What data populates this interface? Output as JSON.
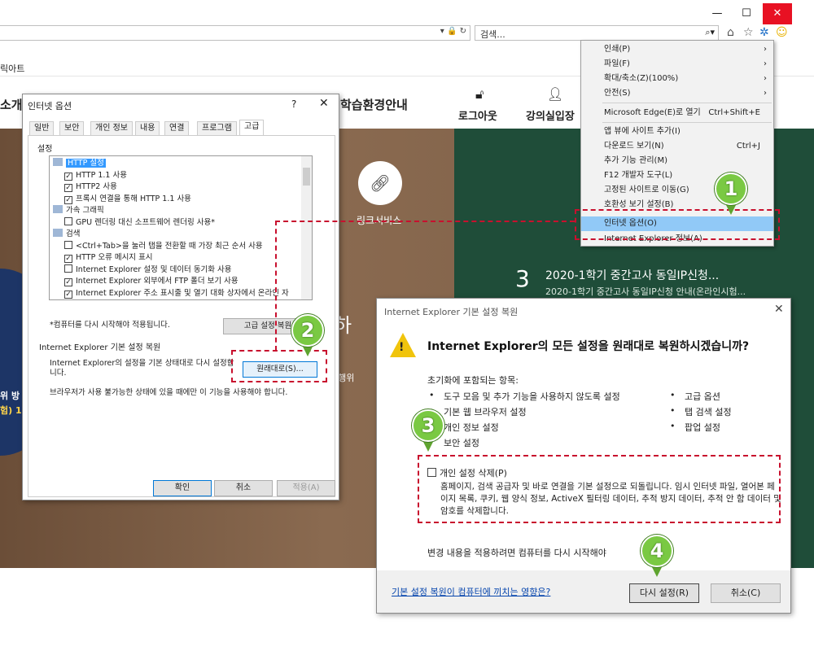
{
  "browser": {
    "window_minimize": "—",
    "window_maximize": "☐",
    "window_close": "✕",
    "search_placeholder": "검색...",
    "address_icons": "▾ 🔒 ↻",
    "search_icon": "⌕▾",
    "favbar_text": "릭아트"
  },
  "site": {
    "nav_left": "소개",
    "nav_env": "학습환경안내",
    "nav_logout": "로그아웃",
    "nav_lecture": "강의실입장",
    "link_service": "링크서비스",
    "notice_num": "3",
    "notice_title": "2020-1학기 중간고사 동일IP신청...",
    "notice_sub": "2020-1학기 중간고사 동일IP신청 안내(온라인시험...",
    "hero_char": "하",
    "hero_small": "정행위",
    "hero_left_1": "위 방",
    "hero_left_2": "험) 1"
  },
  "tools_menu": {
    "items": [
      {
        "label": "인쇄(P)",
        "arrow": "›"
      },
      {
        "label": "파일(F)",
        "arrow": "›"
      },
      {
        "label": "확대/축소(Z)(100%)",
        "arrow": "›"
      },
      {
        "label": "안전(S)",
        "arrow": "›"
      },
      {
        "label": "Microsoft Edge(E)로 열기",
        "shortcut": "Ctrl+Shift+E"
      },
      {
        "label": "앱 뷰에 사이트 추가(I)"
      },
      {
        "label": "다운로드 보기(N)",
        "shortcut": "Ctrl+J"
      },
      {
        "label": "추가 기능 관리(M)"
      },
      {
        "label": "F12 개발자 도구(L)"
      },
      {
        "label": "고정된 사이트로 이동(G)"
      },
      {
        "label": "호환성 보기 설정(B)"
      },
      {
        "label": "인터넷 옵션(O)"
      },
      {
        "label": "Internet Explorer 정보(A)"
      }
    ]
  },
  "internet_options": {
    "title": "인터넷 옵션",
    "help": "?",
    "close": "✕",
    "tabs": [
      "일반",
      "보안",
      "개인 정보",
      "내용",
      "연결",
      "프로그램",
      "고급"
    ],
    "settings_label": "설정",
    "list": [
      {
        "type": "folder",
        "label": "HTTP 설정",
        "selected": true
      },
      {
        "type": "check",
        "label": "HTTP 1.1 사용",
        "checked": true
      },
      {
        "type": "check",
        "label": "HTTP2 사용",
        "checked": true
      },
      {
        "type": "check",
        "label": "프록시 연결을 통해 HTTP 1.1 사용",
        "checked": true
      },
      {
        "type": "folder",
        "label": "가속 그래픽"
      },
      {
        "type": "check",
        "label": "GPU 렌더링 대신 소프트웨어 렌더링 사용*",
        "checked": false
      },
      {
        "type": "folder",
        "label": "검색"
      },
      {
        "type": "check",
        "label": "<Ctrl+Tab>을 눌러 탭을 전환할 때 가장 최근 순서 사용",
        "checked": false
      },
      {
        "type": "check",
        "label": "HTTP 오류 메시지 표시",
        "checked": true
      },
      {
        "type": "check",
        "label": "Internet Explorer 설정 및 데이터 동기화 사용",
        "checked": false
      },
      {
        "type": "check",
        "label": "Internet Explorer 외부에서 FTP 폴더 보기 사용",
        "checked": true
      },
      {
        "type": "check",
        "label": "Internet Explorer 주소 표시줄 및 열기 대화 상자에서 온라인 자",
        "checked": true
      }
    ],
    "restart_note": "*컴퓨터를 다시 시작해야 적용됩니다.",
    "adv_reset_button": "고급 설정 복원",
    "ie_reset_label": "Internet Explorer 기본 설정 복원",
    "ie_reset_text": "Internet Explorer의 설정을 기본 상태대로 다시 설정합니다.",
    "restore_button": "원래대로(S)...",
    "warning_text": "브라우저가 사용 불가능한 상태에 있을 때에만 이 기능을 사용해야 합니다.",
    "ok": "확인",
    "cancel": "취소",
    "apply": "적용(A)"
  },
  "reset_dialog": {
    "title": "Internet Explorer 기본 설정 복원",
    "close": "✕",
    "warn_mark": "!",
    "question": "Internet Explorer의 모든 설정을 원래대로 복원하시겠습니까?",
    "items_label": "초기화에 포함되는 항목:",
    "items_left": [
      "도구 모음 및 추가 기능을 사용하지 않도록 설정",
      "기본 웹 브라우저 설정",
      "개인 정보 설정",
      "보안 설정"
    ],
    "items_right": [
      "고급 옵션",
      "탭 검색 설정",
      "팝업 설정"
    ],
    "bullet": "•",
    "personal_delete_label": "개인 설정 삭제(P)",
    "personal_delete_desc": "홈페이지, 검색 공급자 및 바로 연결을 기본 설정으로 되돌립니다. 임시 인터넷 파일, 열어본 페이지 목록, 쿠키, 웹 양식 정보, ActiveX 필터링 데이터, 추적 방지 데이터, 추적 안 함 데이터 및 암호를 삭제합니다.",
    "restart_text": "변경 내용을 적용하려면 컴퓨터를 다시 시작해야",
    "help_link": "기본 설정 복원이 컴퓨터에 끼치는 영향은?",
    "reset_button": "다시 설정(R)",
    "cancel_button": "취소(C)"
  },
  "steps": [
    "1",
    "2",
    "3",
    "4"
  ]
}
